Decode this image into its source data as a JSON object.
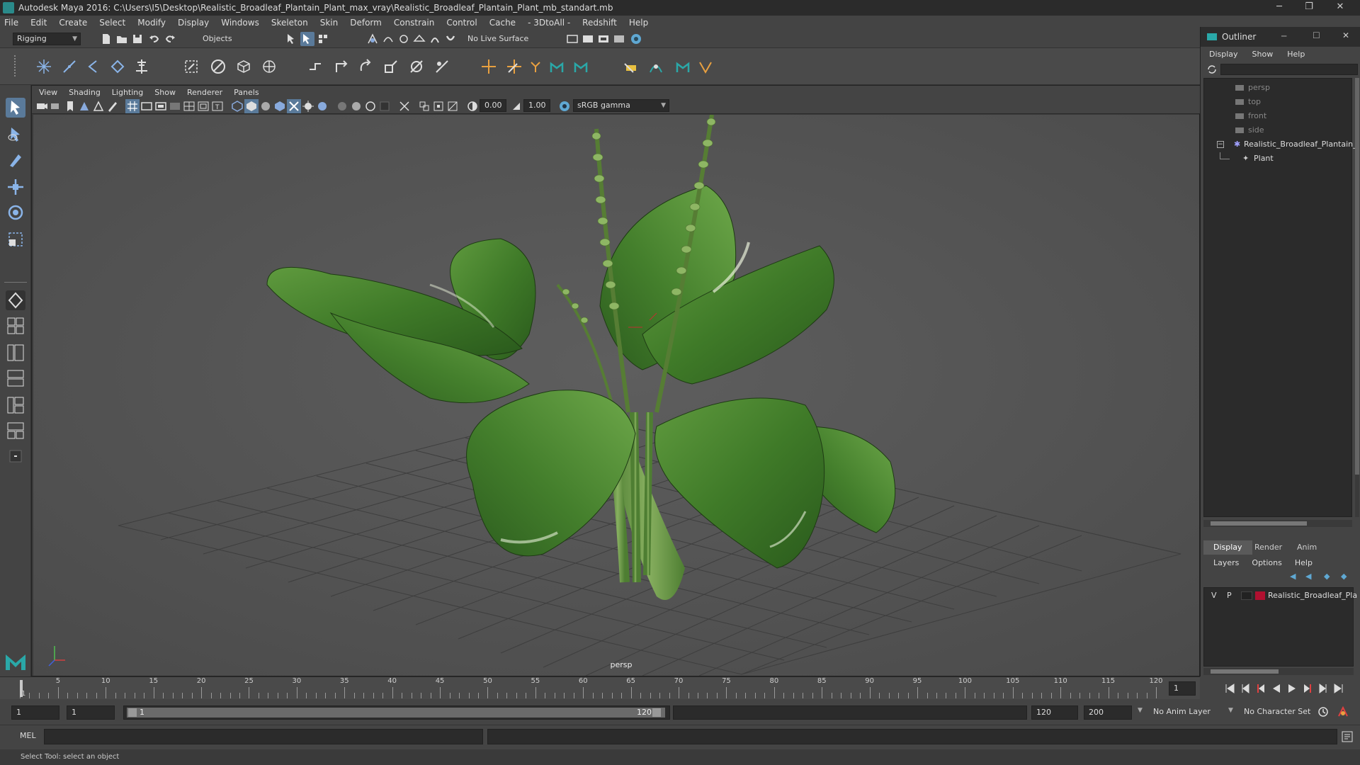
{
  "window": {
    "title": "Autodesk Maya 2016: C:\\Users\\I5\\Desktop\\Realistic_Broadleaf_Plantain_Plant_max_vray\\Realistic_Broadleaf_Plantain_Plant_mb_standart.mb",
    "minimize": "─",
    "restore": "❐",
    "close": "✕"
  },
  "menubar": [
    "File",
    "Edit",
    "Create",
    "Select",
    "Modify",
    "Display",
    "Windows",
    "Skeleton",
    "Skin",
    "Deform",
    "Constrain",
    "Control",
    "Cache",
    "- 3DtoAll -",
    "Redshift",
    "Help"
  ],
  "statusline": {
    "menuset": "Rigging",
    "selection_mode": "Objects",
    "live_surface": "No Live Surface"
  },
  "panel": {
    "menus": [
      "View",
      "Shading",
      "Lighting",
      "Show",
      "Renderer",
      "Panels"
    ],
    "exposure": "0.00",
    "gamma": "1.00",
    "color_space": "sRGB gamma",
    "camera_label": "persp"
  },
  "timeline": {
    "ticks": [
      "1",
      "5",
      "10",
      "15",
      "20",
      "25",
      "30",
      "35",
      "40",
      "45",
      "50",
      "55",
      "60",
      "65",
      "70",
      "75",
      "80",
      "85",
      "90",
      "95",
      "100",
      "105",
      "110",
      "115",
      "120"
    ],
    "current_frame": "1"
  },
  "range": {
    "start": "1",
    "playback_start": "1",
    "slider_start": "1",
    "slider_end": "120",
    "playback_end": "120",
    "end": "200",
    "anim_layer": "No Anim Layer",
    "character_set": "No Character Set"
  },
  "cmdline": {
    "language": "MEL"
  },
  "helpline": {
    "text": "Select Tool: select an object"
  },
  "outliner": {
    "title": "Outliner",
    "menus": [
      "Display",
      "Show",
      "Help"
    ],
    "items": [
      {
        "label": "persp",
        "dim": true
      },
      {
        "label": "top",
        "dim": true
      },
      {
        "label": "front",
        "dim": true
      },
      {
        "label": "side",
        "dim": true
      },
      {
        "label": "Realistic_Broadleaf_Plantain_",
        "dim": false
      },
      {
        "label": "Plant",
        "dim": false
      }
    ]
  },
  "layers": {
    "tabs": [
      "Display",
      "Render",
      "Anim"
    ],
    "menus": [
      "Layers",
      "Options",
      "Help"
    ],
    "row": {
      "v": "V",
      "p": "P",
      "name": "Realistic_Broadleaf_Pla"
    }
  },
  "colors": {
    "layer_color": "#b01030",
    "accent": "#5fa8d3"
  }
}
